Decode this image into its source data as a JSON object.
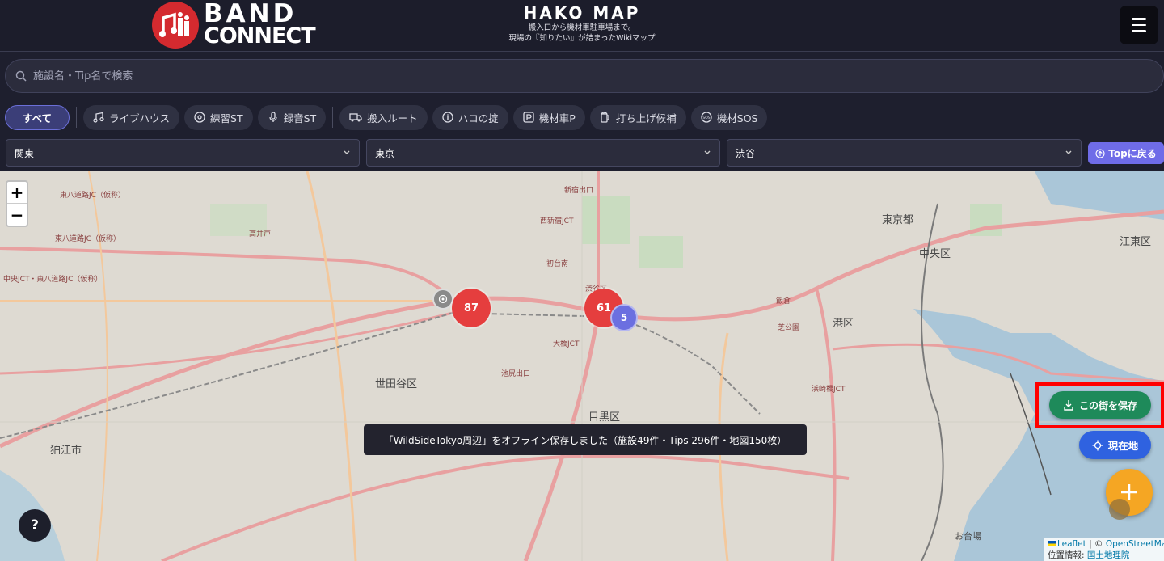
{
  "header": {
    "logo_line1": "BAND",
    "logo_line2": "CONNECT",
    "title": "HAKO MAP",
    "subtitle1": "搬入口から機材車駐車場まで。",
    "subtitle2": "現場の『知りたい』が詰まったWikiマップ"
  },
  "search": {
    "placeholder": "施設名・Tip名で検索"
  },
  "categories": [
    {
      "label": "すべて",
      "icon": "none",
      "active": true
    },
    {
      "label": "ライブハウス",
      "icon": "music-note-icon"
    },
    {
      "label": "練習ST",
      "icon": "disc-icon"
    },
    {
      "label": "録音ST",
      "icon": "microphone-icon"
    },
    {
      "label": "搬入ルート",
      "icon": "truck-icon"
    },
    {
      "label": "ハコの掟",
      "icon": "info-icon"
    },
    {
      "label": "機材車P",
      "icon": "parking-icon"
    },
    {
      "label": "打ち上げ候補",
      "icon": "beer-icon"
    },
    {
      "label": "機材SOS",
      "icon": "sos-icon"
    }
  ],
  "filters": {
    "region": "関東",
    "prefecture": "東京",
    "area": "渋谷",
    "top_button": "Topに戻る"
  },
  "map": {
    "labels": {
      "setagaya": "世田谷区",
      "meguro": "目黒区",
      "minato": "港区",
      "chuo": "中央区",
      "tokyo": "東京都",
      "koto": "江東区",
      "komae": "狛江市",
      "shibuya": "渋谷区",
      "odaiba": "お台場",
      "shinjuku_exit": "新宿出口",
      "nishishinjuku": "西新宿JCT",
      "hatsudai": "初台南",
      "ohashi": "大橋JCT",
      "ikejiri": "池尻出口",
      "tomei": "東八道路JC（仮称）",
      "higashiyatsu": "東八道路JC（仮称）",
      "tokyo_chofu": "中央JCT・東八道路JC（仮称）",
      "takaido": "高井戸",
      "ikebukuro": "飯倉",
      "shibakoen": "芝公園",
      "hamazaki": "浜崎橋JCT"
    },
    "clusters": [
      {
        "count": "87",
        "color": "red"
      },
      {
        "count": "61",
        "color": "red"
      },
      {
        "count": "5",
        "color": "blue"
      }
    ],
    "toast": "「WildSideTokyo周辺」をオフライン保存しました（施設49件・Tips 296件・地図150枚）",
    "save_button": "この街を保存",
    "location_button": "現在地",
    "help": "?",
    "attribution_leaflet": "Leaflet",
    "attribution_sep": " | © ",
    "attribution_osm": "OpenStreetMap",
    "attribution_geo_label": "位置情報:",
    "attribution_geo_link": "国土地理院"
  },
  "colors": {
    "header_bg": "#1c1d2b",
    "accent_purple": "#6f6ce8",
    "cluster_red": "#e53e3e",
    "save_green": "#1e8a5a",
    "location_blue": "#2f62e0",
    "fab_orange": "#f5a623",
    "highlight_red": "#ff0000"
  }
}
